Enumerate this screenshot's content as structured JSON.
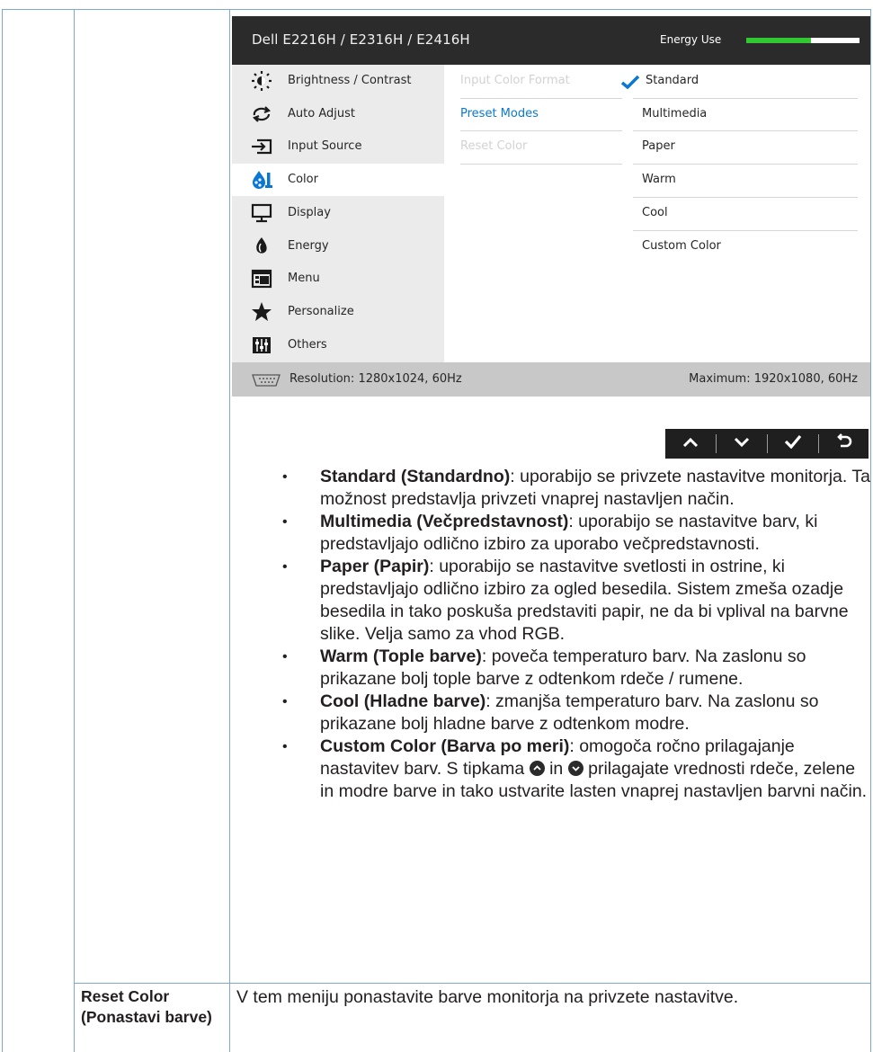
{
  "osd": {
    "title": "Dell E2216H / E2316H / E2416H",
    "energy_label": "Energy Use",
    "energy_level": 0.57,
    "sidebar": [
      {
        "label": "Brightness / Contrast",
        "icon": "brightness-icon"
      },
      {
        "label": "Auto Adjust",
        "icon": "auto-adjust-icon"
      },
      {
        "label": "Input Source",
        "icon": "input-source-icon"
      },
      {
        "label": "Color",
        "icon": "color-icon",
        "active": true
      },
      {
        "label": "Display",
        "icon": "display-icon"
      },
      {
        "label": "Energy",
        "icon": "energy-icon"
      },
      {
        "label": "Menu",
        "icon": "menu-icon"
      },
      {
        "label": "Personalize",
        "icon": "star-icon"
      },
      {
        "label": "Others",
        "icon": "others-icon"
      }
    ],
    "submenu": [
      {
        "label": "Input Color Format",
        "state": "disabled"
      },
      {
        "label": "Preset Modes",
        "state": "selected"
      },
      {
        "label": "Reset Color",
        "state": "disabled"
      }
    ],
    "options": [
      {
        "label": "Standard",
        "checked": true
      },
      {
        "label": "Multimedia"
      },
      {
        "label": "Paper"
      },
      {
        "label": "Warm"
      },
      {
        "label": "Cool"
      },
      {
        "label": "Custom Color"
      }
    ],
    "resolution": "Resolution: 1280x1024, 60Hz",
    "maximum": "Maximum: 1920x1080, 60Hz"
  },
  "colors": {
    "accent_blue": "#0a78d2",
    "energy_green": "#32c832",
    "header_bg": "#2b2b2b",
    "border": "#7fa7d3"
  },
  "nav_buttons": [
    "up-arrow-icon",
    "down-arrow-icon",
    "check-icon",
    "back-icon"
  ],
  "descriptions": [
    {
      "bold": "Standard (Standardno)",
      "text": ": uporabijo se privzete nastavitve monitorja. Ta možnost predstavlja privzeti vnaprej nastavljen način."
    },
    {
      "bold": "Multimedia (Večpredstavnost)",
      "text": ": uporabijo se nastavitve barv, ki predstavljajo odlično izbiro za uporabo večpredstavnosti."
    },
    {
      "bold": "Paper (Papir)",
      "text": ": uporabijo se nastavitve svetlosti in ostrine, ki predstavljajo odlično izbiro za ogled besedila. Sistem zmeša ozadje besedila in tako poskuša predstaviti papir, ne da bi vplival na barvne slike. Velja samo za vhod RGB."
    },
    {
      "bold": "Warm (Tople barve)",
      "text": ": poveča temperaturo barv. Na zaslonu so prikazane bolj tople barve z odtenkom rdeče / rumene."
    },
    {
      "bold": "Cool (Hladne barve)",
      "text": ": zmanjša temperaturo barv. Na zaslonu so prikazane bolj hladne barve z odtenkom modre."
    }
  ],
  "custom_color": {
    "bold": "Custom Color (Barva po meri)",
    "text1": ": omogoča ročno prilagajanje nastavitev barv. S tipkama",
    "text_in": "in",
    "text2": "prilagajate vrednosti rdeče, zelene in modre barve in tako ustvarite lasten vnaprej nastavljen barvni način."
  },
  "reset_color": {
    "label": "Reset Color (Ponastavi barve)",
    "text": "V tem meniju ponastavite barve monitorja na privzete nastavitve."
  }
}
